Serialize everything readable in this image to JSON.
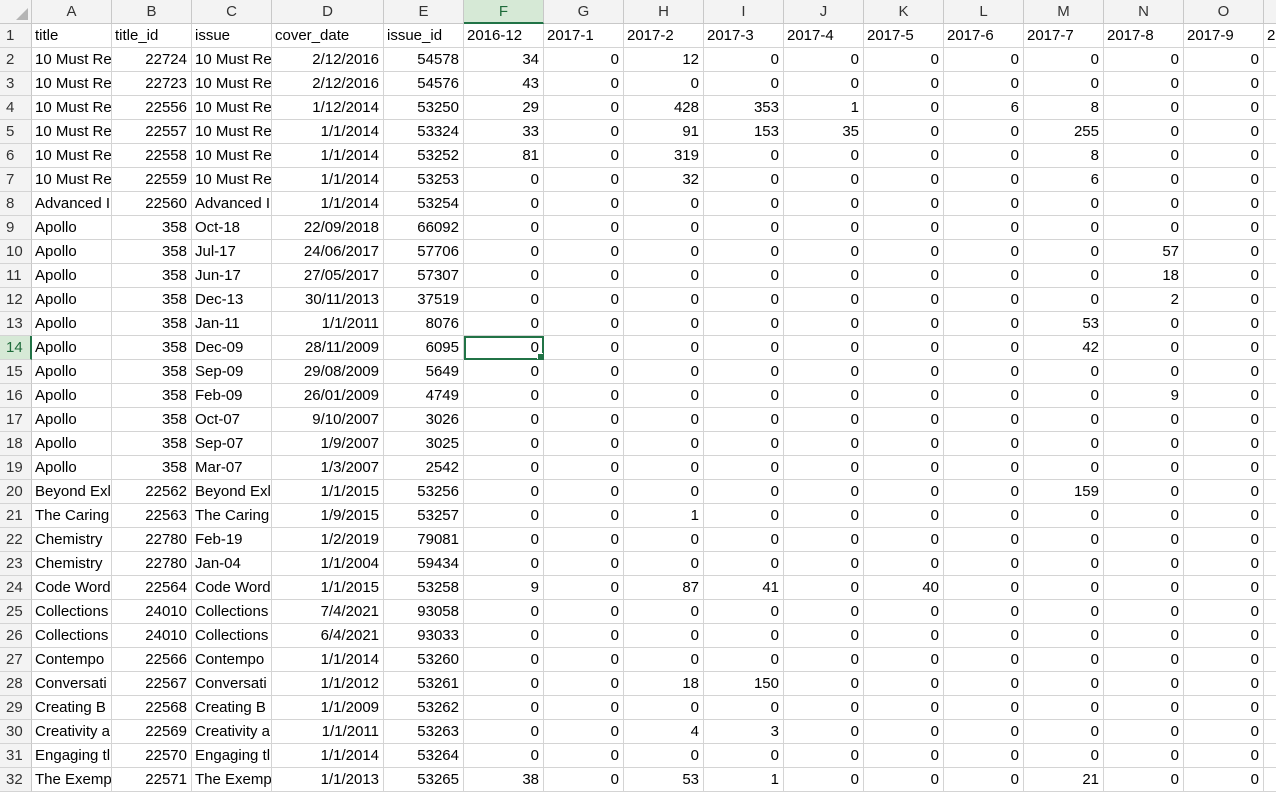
{
  "sheet": {
    "columns": [
      "A",
      "B",
      "C",
      "D",
      "E",
      "F",
      "G",
      "H",
      "I",
      "J",
      "K",
      "L",
      "M",
      "N",
      "O",
      ""
    ],
    "column_types": [
      "txt",
      "num",
      "txt",
      "num",
      "num",
      "num",
      "num",
      "num",
      "num",
      "num",
      "num",
      "num",
      "num",
      "num",
      "num",
      "txt"
    ],
    "active_cell": {
      "row": 14,
      "col": "F"
    },
    "rows": [
      {
        "n": "1",
        "cells": [
          "title",
          "title_id",
          "issue",
          "cover_date",
          "issue_id",
          "2016-12",
          "2017-1",
          "2017-2",
          "2017-3",
          "2017-4",
          "2017-5",
          "2017-6",
          "2017-7",
          "2017-8",
          "2017-9",
          "2"
        ]
      },
      {
        "n": "2",
        "cells": [
          "10 Must Re",
          "22724",
          "10 Must Re",
          "2/12/2016",
          "54578",
          "34",
          "0",
          "12",
          "0",
          "0",
          "0",
          "0",
          "0",
          "0",
          "0",
          ""
        ]
      },
      {
        "n": "3",
        "cells": [
          "10 Must Re",
          "22723",
          "10 Must Re",
          "2/12/2016",
          "54576",
          "43",
          "0",
          "0",
          "0",
          "0",
          "0",
          "0",
          "0",
          "0",
          "0",
          ""
        ]
      },
      {
        "n": "4",
        "cells": [
          "10 Must Re",
          "22556",
          "10 Must Re",
          "1/12/2014",
          "53250",
          "29",
          "0",
          "428",
          "353",
          "1",
          "0",
          "6",
          "8",
          "0",
          "0",
          ""
        ]
      },
      {
        "n": "5",
        "cells": [
          "10 Must Re",
          "22557",
          "10 Must Re",
          "1/1/2014",
          "53324",
          "33",
          "0",
          "91",
          "153",
          "35",
          "0",
          "0",
          "255",
          "0",
          "0",
          ""
        ]
      },
      {
        "n": "6",
        "cells": [
          "10 Must Re",
          "22558",
          "10 Must Re",
          "1/1/2014",
          "53252",
          "81",
          "0",
          "319",
          "0",
          "0",
          "0",
          "0",
          "8",
          "0",
          "0",
          ""
        ]
      },
      {
        "n": "7",
        "cells": [
          "10 Must Re",
          "22559",
          "10 Must Re",
          "1/1/2014",
          "53253",
          "0",
          "0",
          "32",
          "0",
          "0",
          "0",
          "0",
          "6",
          "0",
          "0",
          ""
        ]
      },
      {
        "n": "8",
        "cells": [
          "Advanced I",
          "22560",
          "Advanced I",
          "1/1/2014",
          "53254",
          "0",
          "0",
          "0",
          "0",
          "0",
          "0",
          "0",
          "0",
          "0",
          "0",
          ""
        ]
      },
      {
        "n": "9",
        "cells": [
          "Apollo",
          "358",
          "Oct-18",
          "22/09/2018",
          "66092",
          "0",
          "0",
          "0",
          "0",
          "0",
          "0",
          "0",
          "0",
          "0",
          "0",
          ""
        ]
      },
      {
        "n": "10",
        "cells": [
          "Apollo",
          "358",
          "Jul-17",
          "24/06/2017",
          "57706",
          "0",
          "0",
          "0",
          "0",
          "0",
          "0",
          "0",
          "0",
          "57",
          "0",
          ""
        ]
      },
      {
        "n": "11",
        "cells": [
          "Apollo",
          "358",
          "Jun-17",
          "27/05/2017",
          "57307",
          "0",
          "0",
          "0",
          "0",
          "0",
          "0",
          "0",
          "0",
          "18",
          "0",
          ""
        ]
      },
      {
        "n": "12",
        "cells": [
          "Apollo",
          "358",
          "Dec-13",
          "30/11/2013",
          "37519",
          "0",
          "0",
          "0",
          "0",
          "0",
          "0",
          "0",
          "0",
          "2",
          "0",
          ""
        ]
      },
      {
        "n": "13",
        "cells": [
          "Apollo",
          "358",
          "Jan-11",
          "1/1/2011",
          "8076",
          "0",
          "0",
          "0",
          "0",
          "0",
          "0",
          "0",
          "53",
          "0",
          "0",
          ""
        ]
      },
      {
        "n": "14",
        "cells": [
          "Apollo",
          "358",
          "Dec-09",
          "28/11/2009",
          "6095",
          "0",
          "0",
          "0",
          "0",
          "0",
          "0",
          "0",
          "42",
          "0",
          "0",
          ""
        ]
      },
      {
        "n": "15",
        "cells": [
          "Apollo",
          "358",
          "Sep-09",
          "29/08/2009",
          "5649",
          "0",
          "0",
          "0",
          "0",
          "0",
          "0",
          "0",
          "0",
          "0",
          "0",
          ""
        ]
      },
      {
        "n": "16",
        "cells": [
          "Apollo",
          "358",
          "Feb-09",
          "26/01/2009",
          "4749",
          "0",
          "0",
          "0",
          "0",
          "0",
          "0",
          "0",
          "0",
          "9",
          "0",
          ""
        ]
      },
      {
        "n": "17",
        "cells": [
          "Apollo",
          "358",
          "Oct-07",
          "9/10/2007",
          "3026",
          "0",
          "0",
          "0",
          "0",
          "0",
          "0",
          "0",
          "0",
          "0",
          "0",
          ""
        ]
      },
      {
        "n": "18",
        "cells": [
          "Apollo",
          "358",
          "Sep-07",
          "1/9/2007",
          "3025",
          "0",
          "0",
          "0",
          "0",
          "0",
          "0",
          "0",
          "0",
          "0",
          "0",
          ""
        ]
      },
      {
        "n": "19",
        "cells": [
          "Apollo",
          "358",
          "Mar-07",
          "1/3/2007",
          "2542",
          "0",
          "0",
          "0",
          "0",
          "0",
          "0",
          "0",
          "0",
          "0",
          "0",
          ""
        ]
      },
      {
        "n": "20",
        "cells": [
          "Beyond Exl",
          "22562",
          "Beyond Exl",
          "1/1/2015",
          "53256",
          "0",
          "0",
          "0",
          "0",
          "0",
          "0",
          "0",
          "159",
          "0",
          "0",
          ""
        ]
      },
      {
        "n": "21",
        "cells": [
          "The Caring",
          "22563",
          "The Caring",
          "1/9/2015",
          "53257",
          "0",
          "0",
          "1",
          "0",
          "0",
          "0",
          "0",
          "0",
          "0",
          "0",
          ""
        ]
      },
      {
        "n": "22",
        "cells": [
          "Chemistry",
          "22780",
          "Feb-19",
          "1/2/2019",
          "79081",
          "0",
          "0",
          "0",
          "0",
          "0",
          "0",
          "0",
          "0",
          "0",
          "0",
          ""
        ]
      },
      {
        "n": "23",
        "cells": [
          "Chemistry",
          "22780",
          "Jan-04",
          "1/1/2004",
          "59434",
          "0",
          "0",
          "0",
          "0",
          "0",
          "0",
          "0",
          "0",
          "0",
          "0",
          ""
        ]
      },
      {
        "n": "24",
        "cells": [
          "Code Word",
          "22564",
          "Code Word",
          "1/1/2015",
          "53258",
          "9",
          "0",
          "87",
          "41",
          "0",
          "40",
          "0",
          "0",
          "0",
          "0",
          ""
        ]
      },
      {
        "n": "25",
        "cells": [
          "Collections",
          "24010",
          "Collections",
          "7/4/2021",
          "93058",
          "0",
          "0",
          "0",
          "0",
          "0",
          "0",
          "0",
          "0",
          "0",
          "0",
          ""
        ]
      },
      {
        "n": "26",
        "cells": [
          "Collections",
          "24010",
          "Collections",
          "6/4/2021",
          "93033",
          "0",
          "0",
          "0",
          "0",
          "0",
          "0",
          "0",
          "0",
          "0",
          "0",
          ""
        ]
      },
      {
        "n": "27",
        "cells": [
          "Contempo",
          "22566",
          "Contempo",
          "1/1/2014",
          "53260",
          "0",
          "0",
          "0",
          "0",
          "0",
          "0",
          "0",
          "0",
          "0",
          "0",
          ""
        ]
      },
      {
        "n": "28",
        "cells": [
          "Conversati",
          "22567",
          "Conversati",
          "1/1/2012",
          "53261",
          "0",
          "0",
          "18",
          "150",
          "0",
          "0",
          "0",
          "0",
          "0",
          "0",
          ""
        ]
      },
      {
        "n": "29",
        "cells": [
          "Creating B",
          "22568",
          "Creating B",
          "1/1/2009",
          "53262",
          "0",
          "0",
          "0",
          "0",
          "0",
          "0",
          "0",
          "0",
          "0",
          "0",
          ""
        ]
      },
      {
        "n": "30",
        "cells": [
          "Creativity a",
          "22569",
          "Creativity a",
          "1/1/2011",
          "53263",
          "0",
          "0",
          "4",
          "3",
          "0",
          "0",
          "0",
          "0",
          "0",
          "0",
          ""
        ]
      },
      {
        "n": "31",
        "cells": [
          "Engaging tl",
          "22570",
          "Engaging tl",
          "1/1/2014",
          "53264",
          "0",
          "0",
          "0",
          "0",
          "0",
          "0",
          "0",
          "0",
          "0",
          "0",
          ""
        ]
      },
      {
        "n": "32",
        "cells": [
          "The Exemp",
          "22571",
          "The Exemp",
          "1/1/2013",
          "53265",
          "38",
          "0",
          "53",
          "1",
          "0",
          "0",
          "0",
          "21",
          "0",
          "0",
          ""
        ]
      }
    ]
  }
}
